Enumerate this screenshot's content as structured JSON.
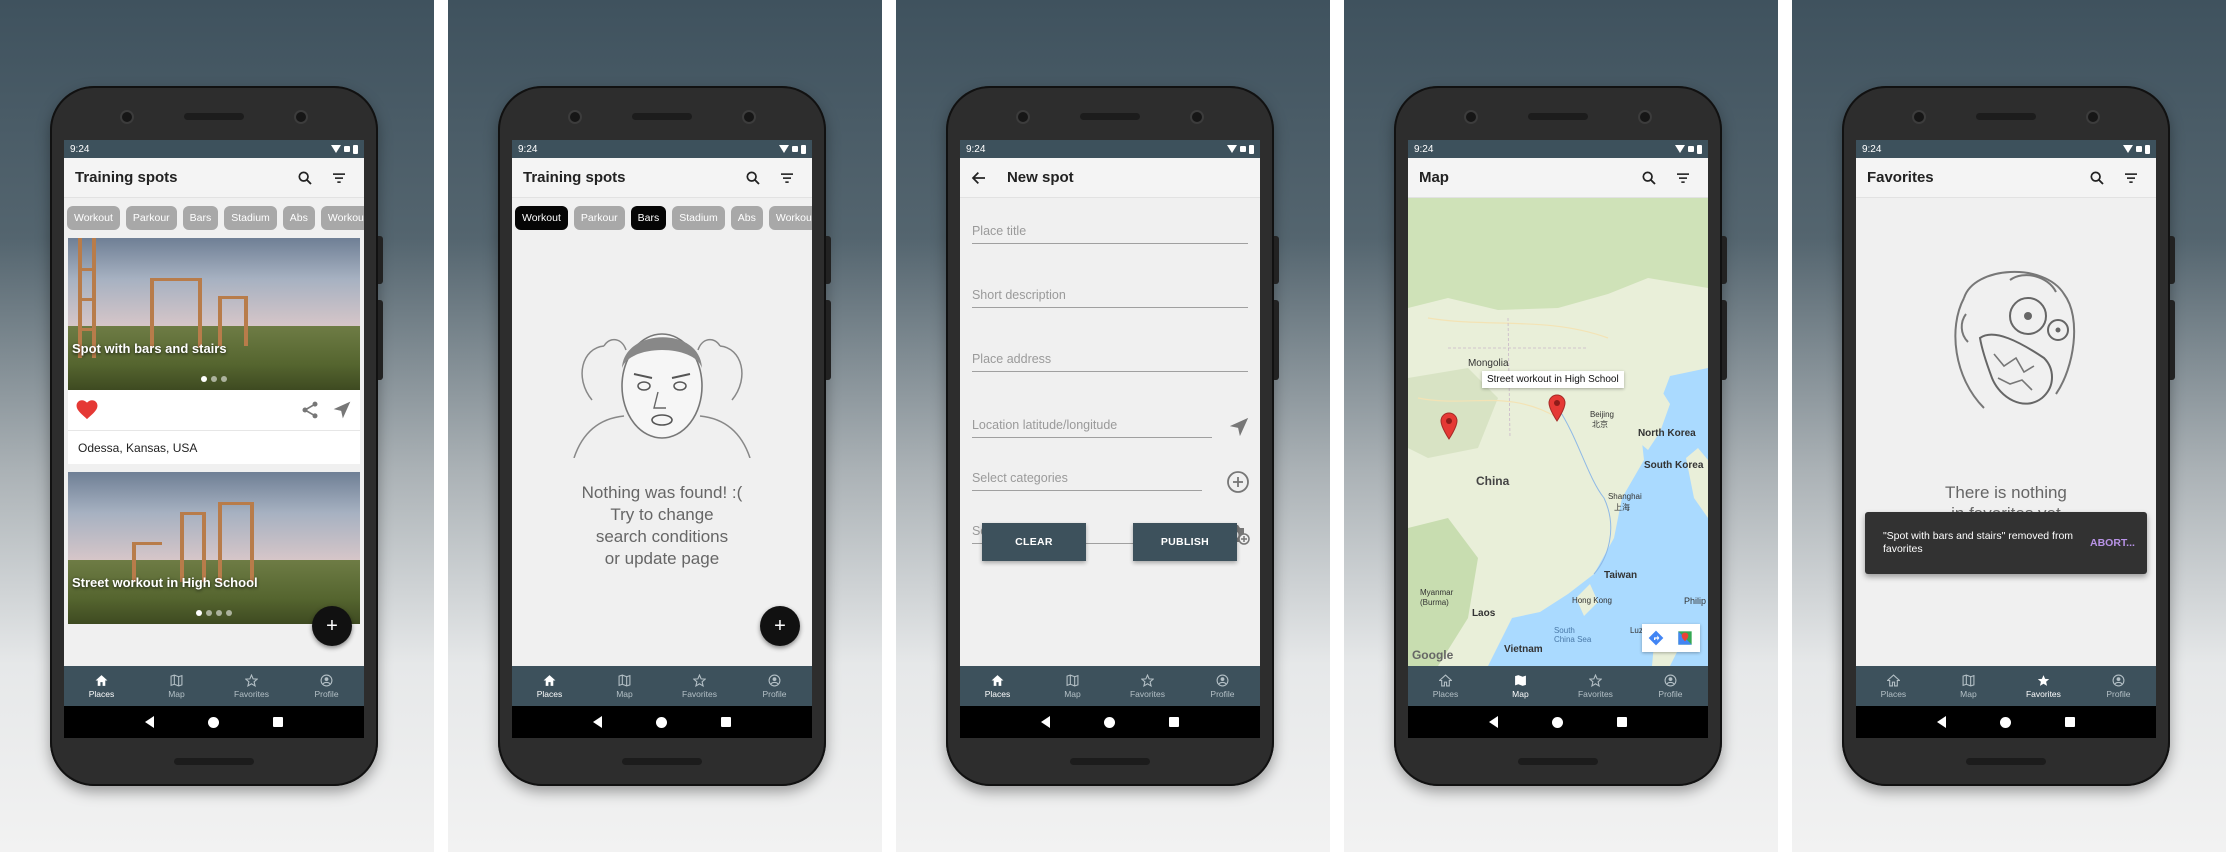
{
  "status_time": "9:24",
  "nav_items": [
    "Places",
    "Map",
    "Favorites",
    "Profile"
  ],
  "chips": [
    "Workout",
    "Parkour",
    "Bars",
    "Stadium",
    "Abs",
    "Workout"
  ],
  "screen1": {
    "title": "Training spots",
    "cards": [
      {
        "caption": "Spot with bars and stairs",
        "address": "Odessa, Kansas, USA"
      },
      {
        "caption": "Street workout in High School"
      }
    ],
    "fab": "+"
  },
  "screen2": {
    "title": "Training spots",
    "selected_chips": [
      "Workout",
      "Bars"
    ],
    "empty_lines": [
      "Nothing was found! :(",
      "Try to change",
      "search conditions",
      "or update page"
    ],
    "fab": "+"
  },
  "screen3": {
    "title": "New spot",
    "fields": {
      "place_title": "Place title",
      "short_description": "Short description",
      "place_address": "Place address",
      "location": "Location latitude/longitude",
      "categories": "Select categories",
      "photos": "Select photos"
    },
    "clear_label": "CLEAR",
    "publish_label": "PUBLISH"
  },
  "screen4": {
    "title": "Map",
    "labels": {
      "mongolia": "Mongolia",
      "beijing": "Beijing",
      "beijing_cn": "北京",
      "north_korea": "North Korea",
      "south_korea": "South Korea",
      "china": "China",
      "shanghai": "Shanghai",
      "shanghai_cn": "上海",
      "taiwan": "Taiwan",
      "myanmar": "Myanmar (Burma)",
      "laos": "Laos",
      "vietnam": "Vietnam",
      "hong_kong": "Hong Kong",
      "south_china_sea": "South China Sea",
      "luzon": "Luzon",
      "philippines": "Philip",
      "google": "Google"
    },
    "tooltip": "Street workout in High School"
  },
  "screen5": {
    "title": "Favorites",
    "empty_lines": [
      "There is nothing",
      "in favorites yet"
    ],
    "snackbar_msg": "\"Spot with bars and stairs\" removed from favorites",
    "snackbar_action": "ABORT..."
  },
  "colors": {
    "primary": "#3d515c",
    "accent": "#e53935",
    "snackbar_action": "#b893e6"
  },
  "icons": [
    "search-icon",
    "filter-icon",
    "heart-icon",
    "share-icon",
    "navigate-icon",
    "home-icon",
    "map-icon",
    "star-icon",
    "profile-icon",
    "back-arrow-icon",
    "add-circle-icon",
    "camera-add-icon",
    "map-pin-icon"
  ]
}
